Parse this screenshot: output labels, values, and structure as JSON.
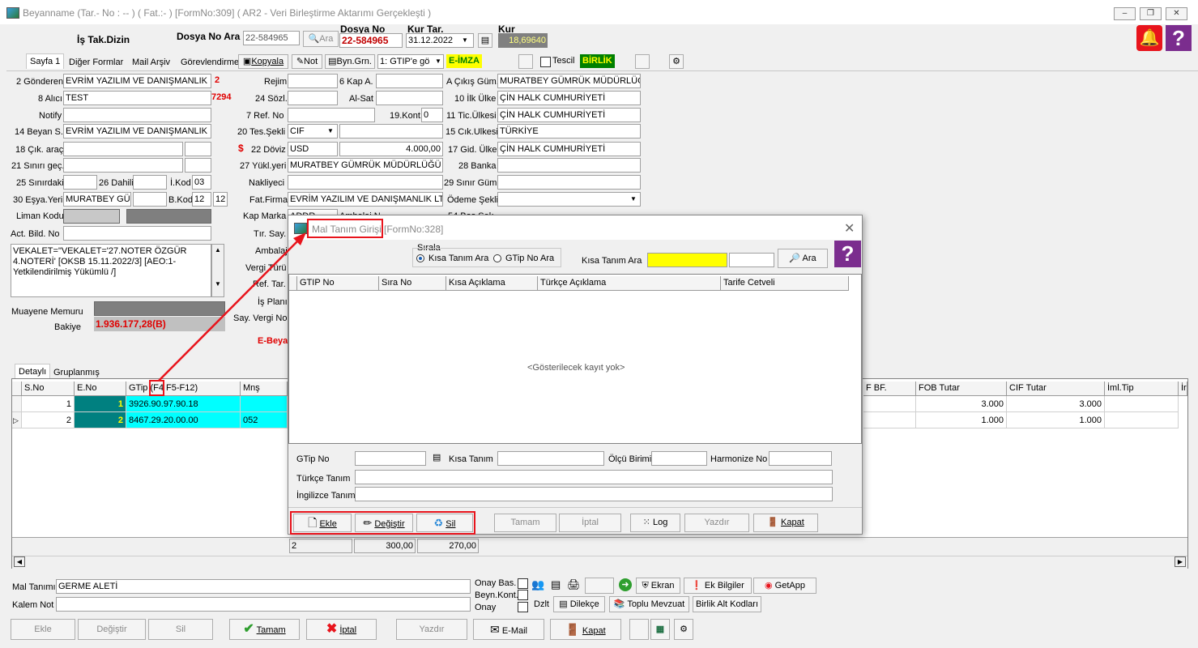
{
  "window": {
    "title": "Beyanname (Tar.- No : -- ) ( Fat.:- ) [FormNo:309] ( AR2 - Veri Birleştirme Aktarımı Gerçekleşti )",
    "minimize": "–",
    "restore": "❐",
    "close": "✕"
  },
  "header": {
    "is_tak_dizin": "İş Tak.Dizin",
    "dosya_no_ara_label": "Dosya No Ara",
    "dosya_no_ara_value": "22-584965",
    "ara_label": "Ara",
    "dosya_no_label": "Dosya No",
    "dosya_no_value": "22-584965",
    "kur_tar_label": "Kur Tar.",
    "kur_tar_value": "31.12.2022",
    "kur_label": "Kur",
    "kur_value": "18,69640"
  },
  "tabs": {
    "sayfa1": "Sayfa 1",
    "diger_formlar": "Diğer Formlar",
    "mail_arsiv": "Mail Arşiv",
    "gorevlendirme": "Görevlendirme",
    "kopyala": "Kopyala",
    "not": "Not",
    "byn_grn": "Byn.Grn.",
    "gtip_combo": "1: GTIP'e gö",
    "e_imza": "E-İMZA",
    "tescil": "Tescil",
    "birlik": "BİRLİK"
  },
  "left_form": {
    "gonderen_label": "2 Gönderen",
    "gonderen_value": "EVRİM YAZILIM VE DANIŞMANLIK L",
    "gonderen_num": "2",
    "alici_label": "8 Alıcı",
    "alici_value": "TEST",
    "alici_num": "7294",
    "notify_label": "Notify",
    "beyan_label": "14 Beyan S.",
    "beyan_value": "EVRİM YAZILIM VE DANIŞMANLIK",
    "cik_arac_label": "18 Çık. araç",
    "sinir_gec_label": "21 Sınırı geç.",
    "sinirdaki_label": "25 Sınırdaki",
    "dahili_label": "26 Dahili",
    "ikod_label": "İ.Kod",
    "ikod_value": "03",
    "esya_yeri_label": "30 Eşya.Yeri",
    "esya_yeri_value": "MURATBEY GÜ",
    "bkod_label": "B.Kod",
    "bkod_value": "12",
    "bkod_value2": "12",
    "liman_kodu_label": "Liman Kodu",
    "act_bild_label": "Act. Bild. No",
    "vekalet_text": "VEKALET=\"VEKALET='27.NOTER ÖZGÜR 4.NOTERİ' [OKSB 15.11.2022/3] [AEO:1-Yetkilendirilmiş Yükümlü /]",
    "muayene_label": "Muayene Memuru",
    "bakiye_label": "Bakiye",
    "bakiye_value": "1.936.177,28(B)"
  },
  "mid_form": {
    "rejim_label": "Rejim",
    "kap_label": "6 Kap A.",
    "sozl_label": "24 Sözl.",
    "alsat_label": "Al-Sat",
    "refno_label": "7 Ref. No",
    "kont_label": "19.Kont.",
    "kont_value": "0",
    "tes_sekli_label": "20 Tes.Şekli",
    "tes_sekli_value": "CIF",
    "doviz_symbol": "$",
    "doviz_label": "22 Döviz",
    "doviz_value": "USD",
    "doviz_amount": "4.000,00",
    "yukl_yeri_label": "27 Yükl.yeri",
    "yukl_yeri_value": "MURATBEY GÜMRÜK MÜDÜRLÜĞÜ",
    "nakliyeci_label": "Nakliyeci",
    "fat_firma_label": "Fat.Firma",
    "fat_firma_value": "EVRİM YAZILIM VE DANIŞMANLIK LT",
    "kap_marka_label": "Kap Marka",
    "kap_marka_value": "ADDR",
    "ambalaj_no_label": "Ambalaj N",
    "tir_say_label": "Tır. Say.",
    "ambalaj_label": "Ambalaj",
    "vergi_turu_label": "Vergi Türü",
    "ref_tar_label": "Ref. Tar.",
    "is_plani_label": "İş Planı",
    "say_vergi_label": "Say. Vergi No",
    "e_beyan": "E-Beya"
  },
  "right_form": {
    "cikis_gum_label": "A Çıkış Güm.",
    "cikis_gum_value": "MURATBEY GÜMRÜK MÜDÜRLÜĞ",
    "ilk_ulke_label": "10 İlk Ülke",
    "ilk_ulke_value": "ÇİN HALK CUMHURİYETİ",
    "tic_ulkesi_label": "11 Tic.Ülkesi",
    "tic_ulkesi_value": "ÇİN HALK CUMHURİYETİ",
    "cik_ulkesi_label": "15 Cık.Ulkesi",
    "cik_ulkesi_value": "TÜRKİYE",
    "gid_ulke_label": "17 Gid. Ülke",
    "gid_ulke_value": "ÇİN HALK CUMHURİYETİ",
    "banka_label": "28 Banka",
    "sinir_gum_label": "29 Sınır Güm.",
    "odeme_label": "Ödeme Şekli",
    "bas_sek_label": "54 Baş.Şek."
  },
  "grid": {
    "tabs": [
      "Detaylı",
      "Gruplanmış"
    ],
    "headers": {
      "sno": "S.No",
      "eno": "E.No",
      "gtip": "GTip (F4 F5-F12)",
      "mns": "Mnş",
      "fbf": "F BF.",
      "fob": "FOB Tutar",
      "cif": "CIF Tutar",
      "iml": "İml.Tip",
      "last": "İr"
    },
    "rows": [
      {
        "sno": "1",
        "eno": "1",
        "gtip": "3926.90.97.90.18",
        "mns": "",
        "fob": "3.000",
        "cif": "3.000"
      },
      {
        "sno": "2",
        "eno": "2",
        "gtip": "8467.29.20.00.00",
        "mns": "052",
        "fob": "1.000",
        "cif": "1.000"
      }
    ],
    "footer": {
      "count": "2",
      "total1": "300,00",
      "total2": "270,00"
    }
  },
  "dialog": {
    "title": "Mal Tanım Girişi",
    "formno": "[FormNo:328]",
    "sirala": "Sırala",
    "radio1": "Kısa Tanım Ara",
    "radio2": "GTip No  Ara",
    "kisa_tanim_ara_label": "Kısa Tanım Ara",
    "ara": "Ara",
    "cols": [
      "GTIP No",
      "Sıra No",
      "Kısa Açıklama",
      "Türkçe Açıklama",
      "Tarife Cetveli"
    ],
    "empty": "<Gösterilecek kayıt yok>",
    "gtip_no_label": "GTip No",
    "kisa_tanim_label": "Kısa Tanım",
    "olcu_label": "Ölçü Birimi",
    "harmonize_label": "Harmonize No",
    "turkce_label": "Türkçe Tanım",
    "ingilizce_label": "İngilizce Tanım",
    "ekle": "Ekle",
    "degistir": "Değiştir",
    "sil": "Sil",
    "tamam": "Tamam",
    "iptal": "İptal",
    "log": "Log",
    "yazdir": "Yazdır",
    "kapat": "Kapat"
  },
  "bottom": {
    "mal_tanimi_label": "Mal Tanımı",
    "mal_tanimi_value": "GERME ALETİ",
    "kalem_not_label": "Kalem Not",
    "onay_bas": "Onay Bas.",
    "beyn_kont": "Beyn.Kont.",
    "onay": "Onay",
    "ekran": "Ekran",
    "ek_bilgiler": "Ek Bilgiler",
    "getapp": "GetApp",
    "dzlt": "Dzlt",
    "dilekce": "Dilekçe",
    "toplu_mevzuat": "Toplu Mevzuat",
    "birlik_alt": "Birlik Alt Kodları",
    "ekle": "Ekle",
    "degistir": "Değiştir",
    "sil": "Sil",
    "tamam": "Tamam",
    "iptal": "İptal",
    "yazdir": "Yazdır",
    "email": "E-Mail",
    "kapat": "Kapat"
  },
  "colors": {
    "accent_red": "#e8141c",
    "cyan": "#00ffff",
    "teal": "#008080",
    "yellow": "#ffff00",
    "purple": "#7b2d8e"
  }
}
